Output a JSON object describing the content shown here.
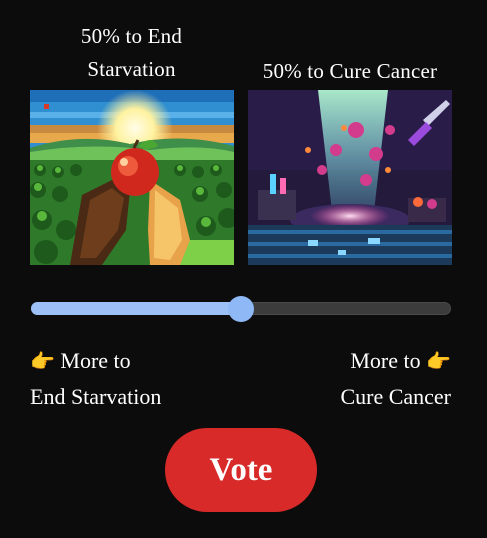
{
  "options": {
    "left": {
      "caption_line1": "50% to End",
      "caption_line2": "Starvation",
      "choice_line1": "More to",
      "choice_line2": "End Starvation",
      "pointer_icon": "pointing-right-hand-icon"
    },
    "right": {
      "caption": "50% to Cure Cancer",
      "choice_line1": "More to",
      "choice_line2": "Cure Cancer",
      "pointer_icon": "pointing-left-hand-icon"
    }
  },
  "slider": {
    "value": 0.5
  },
  "vote": {
    "label": "Vote"
  },
  "colors": {
    "background": "#0c0c0c",
    "slider_fill": "#9dc0f7",
    "slider_track": "#3c3c3c",
    "vote_button": "#d82a28"
  }
}
